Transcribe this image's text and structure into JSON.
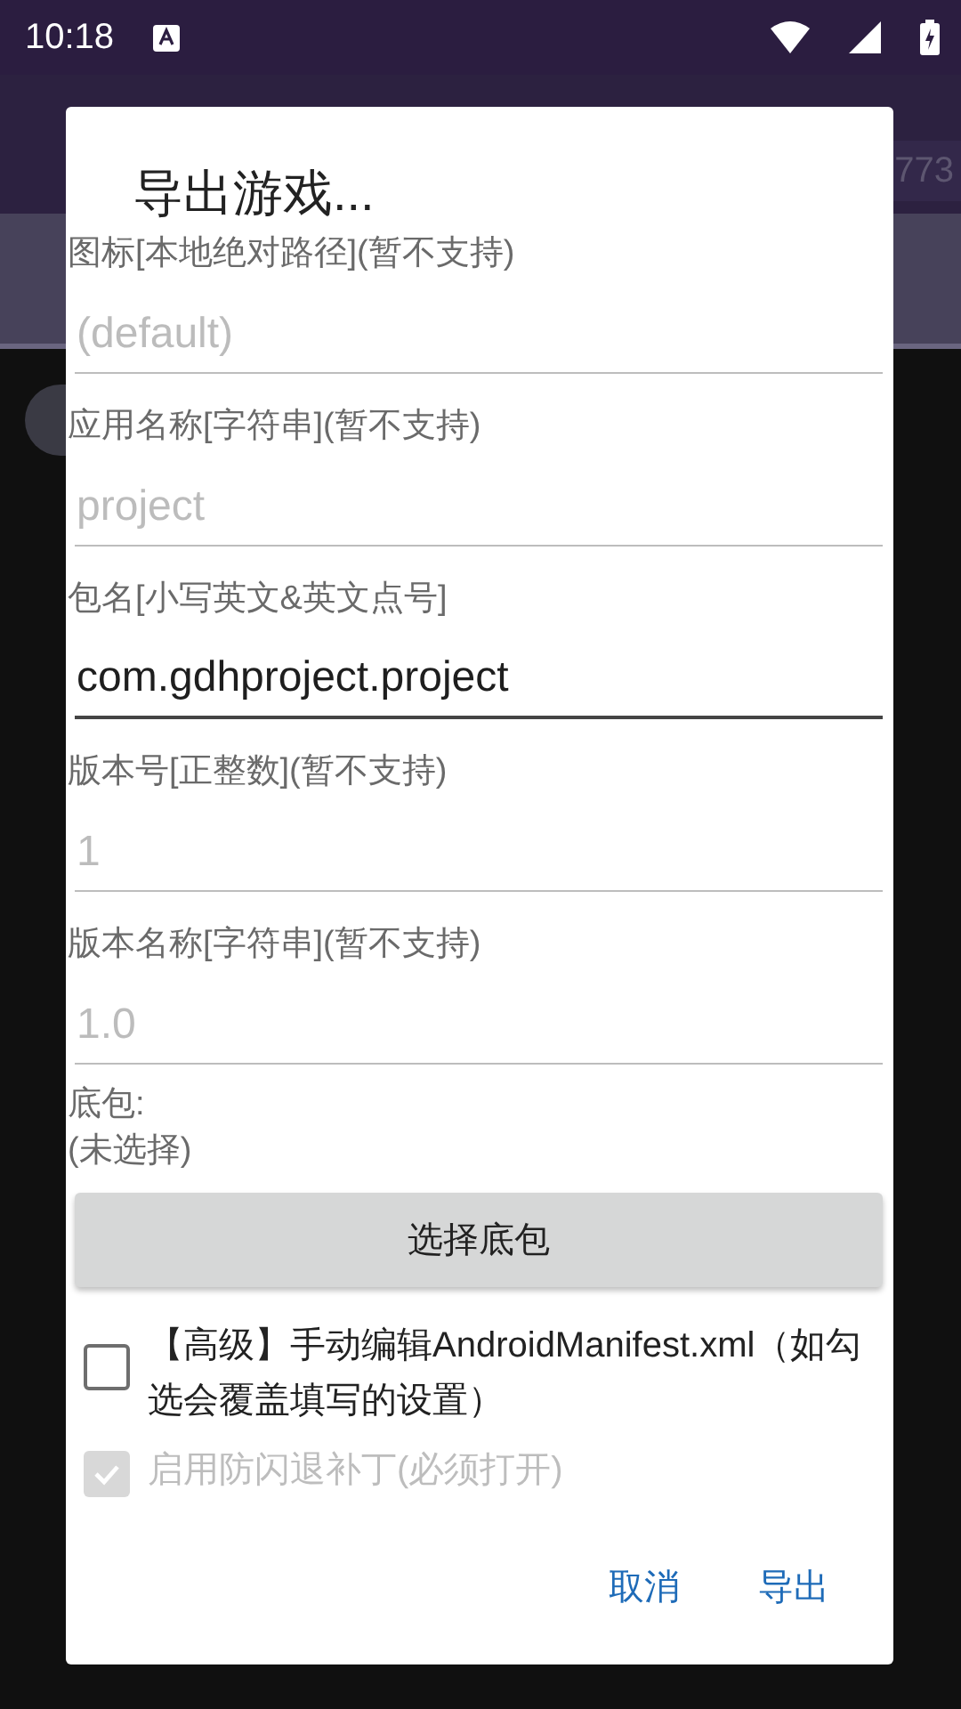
{
  "status_bar": {
    "time": "10:18"
  },
  "background": {
    "watermark_number": "773"
  },
  "dialog": {
    "title": "导出游戏...",
    "fields": [
      {
        "label": "图标[本地绝对路径](暂不支持)",
        "placeholder": "(default)",
        "disabled": true
      },
      {
        "label": "应用名称[字符串](暂不支持)",
        "placeholder": "project",
        "disabled": true
      },
      {
        "label": "包名[小写英文&英文点号]",
        "value": "com.gdhproject.project",
        "disabled": false
      },
      {
        "label": "版本号[正整数](暂不支持)",
        "placeholder": "1",
        "disabled": true
      },
      {
        "label": "版本名称[字符串](暂不支持)",
        "placeholder": "1.0",
        "disabled": true
      }
    ],
    "base_package": {
      "label": "底包:",
      "value": "(未选择)",
      "button": "选择底包"
    },
    "checkboxes": [
      {
        "label": "【高级】手动编辑AndroidManifest.xml（如勾选会覆盖填写的设置）",
        "checked": false,
        "disabled": false
      },
      {
        "label": "启用防闪退补丁(必须打开)",
        "checked": true,
        "disabled": true
      }
    ],
    "buttons": [
      "取消",
      "导出"
    ]
  }
}
